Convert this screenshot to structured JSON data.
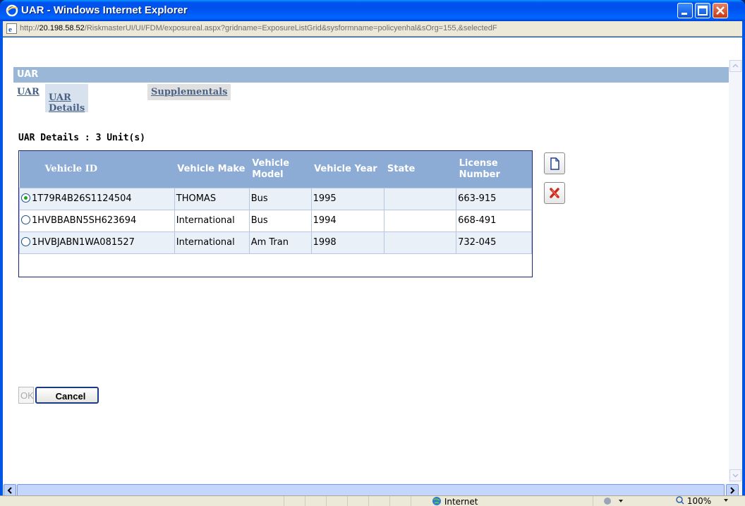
{
  "window": {
    "title": "UAR - Windows Internet Explorer"
  },
  "address": {
    "url_prefix": "http://",
    "host": "20.198.58.52",
    "path": "/RiskmasterUI/UI/FDM/exposureal.aspx?gridname=ExposureListGrid&sysformname=policyenhal&sOrg=155,&selectedF"
  },
  "form": {
    "header": "UAR",
    "tabs": [
      {
        "label": "UAR"
      },
      {
        "label": "UAR Details"
      },
      {
        "label": "Supplementals"
      }
    ]
  },
  "grid": {
    "caption": "UAR Details :  3 Unit(s)",
    "columns": [
      "Vehicle ID",
      "Vehicle Make",
      "Vehicle Model",
      "Vehicle Year",
      "State",
      "License Number"
    ],
    "rows": [
      {
        "selected": true,
        "cells": [
          "1T79R4B26S1124504",
          "THOMAS",
          "Bus",
          "1995",
          "",
          "663-915"
        ]
      },
      {
        "selected": false,
        "cells": [
          "1HVBBABN5SH623694",
          "International",
          "Bus",
          "1994",
          "",
          "668-491"
        ]
      },
      {
        "selected": false,
        "cells": [
          "1HVBJABN1WA081527",
          "International",
          "Am Tran",
          "1998",
          "",
          "732-045"
        ]
      }
    ]
  },
  "buttons": {
    "ok": "OK",
    "cancel": "Cancel"
  },
  "icons": {
    "new": "new-document-icon",
    "delete": "delete-x-icon"
  },
  "statusbar": {
    "zone": "Internet",
    "zoom": "100%"
  },
  "colors": {
    "header_bg": "#9ab7d8",
    "grid_header_bg": "#8cabd5",
    "titlebar": "#0055e5"
  }
}
